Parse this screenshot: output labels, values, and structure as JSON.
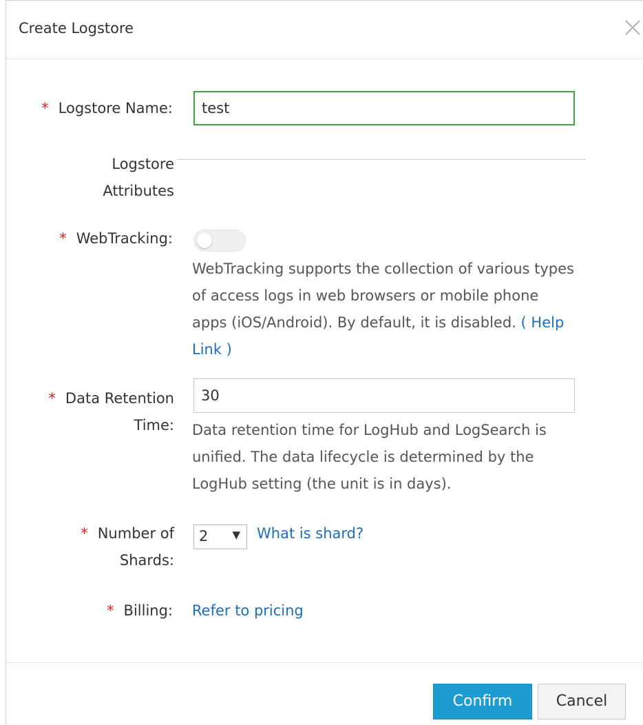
{
  "dialog": {
    "title": "Create Logstore",
    "close_icon": "close-icon"
  },
  "form": {
    "logstore_name": {
      "label": "Logstore Name:",
      "required_mark": "*",
      "value": "test"
    },
    "attributes_section": {
      "line1": "Logstore",
      "line2": "Attributes"
    },
    "webtracking": {
      "label": "WebTracking:",
      "required_mark": "*",
      "enabled": false,
      "help_text": "WebTracking supports the collection of various types of access logs in web browsers or mobile phone apps (iOS/Android). By default, it is disabled.",
      "help_link": "( Help Link )"
    },
    "data_retention": {
      "label_line1": "Data Retention",
      "label_line2": "Time:",
      "required_mark": "*",
      "value": "30",
      "help_text": "Data retention time for LogHub and LogSearch is unified. The data lifecycle is determined by the LogHub setting (the unit is in days)."
    },
    "shards": {
      "label_line1": "Number of",
      "label_line2": "Shards:",
      "required_mark": "*",
      "selected": "2",
      "arrow": "▼",
      "help_link": "What is shard?"
    },
    "billing": {
      "label": "Billing:",
      "required_mark": "*",
      "link": "Refer to pricing"
    }
  },
  "footer": {
    "confirm_label": "Confirm",
    "cancel_label": "Cancel"
  },
  "colors": {
    "primary_button": "#1d9ccf",
    "link": "#1a6fc0",
    "required": "#e02020",
    "focus_border": "#3ca63c"
  }
}
